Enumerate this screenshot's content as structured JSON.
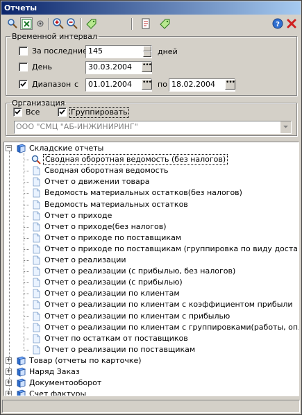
{
  "window": {
    "title": "Отчеты"
  },
  "interval": {
    "legend": "Временной интервал",
    "last": {
      "label": "За последние",
      "value": "145",
      "unit": "дней",
      "checked": false
    },
    "day": {
      "label": "День",
      "value": "30.03.2004",
      "checked": false
    },
    "range": {
      "label": "Диапазон",
      "from_label": "с",
      "from": "01.01.2004",
      "to_label": "по",
      "to": "18.02.2004",
      "checked": true
    }
  },
  "org": {
    "legend": "Организация",
    "all_label": "Все",
    "group_label": "Группировать",
    "selected": "ООО \"СМЦ \"АБ-ИНЖИНИРИНГ\""
  },
  "tree": {
    "root": "Складские отчеты",
    "items": [
      "Сводная оборотная ведомость (без налогов)",
      "Сводная оборотная ведомость",
      "Отчет о движении товара",
      "Ведомость материальных остатков(без налогов)",
      "Ведомость материальных остатков",
      "Отчет о приходе",
      "Отчет о приходе(без налогов)",
      "Отчет о приходе по поставщикам",
      "Отчет о приходе по поставщикам (группировка по виду доставки)",
      "Отчет о реализации",
      "Отчет о реализации (с прибылью, без налогов)",
      "Отчет о реализации (с прибылью)",
      "Отчет о реализации по клиентам",
      "Отчет о реализации по клиентам с коэффициентом прибыли",
      "Отчет о реализации по клиентам с прибылью",
      "Отчет о реализации по клиентам с группировками(работы, оплаты)",
      "Отчет по остаткам от поставщиков",
      "Отчет о реализации по поставщикам"
    ],
    "collapsed": [
      "Товар (отчеты по карточке)",
      "Наряд Заказ",
      "Документооборот",
      "Счет фактуры"
    ]
  },
  "colors": {
    "title_start": "#0a246a",
    "title_end": "#a6caf0",
    "face": "#d4d0c8"
  }
}
